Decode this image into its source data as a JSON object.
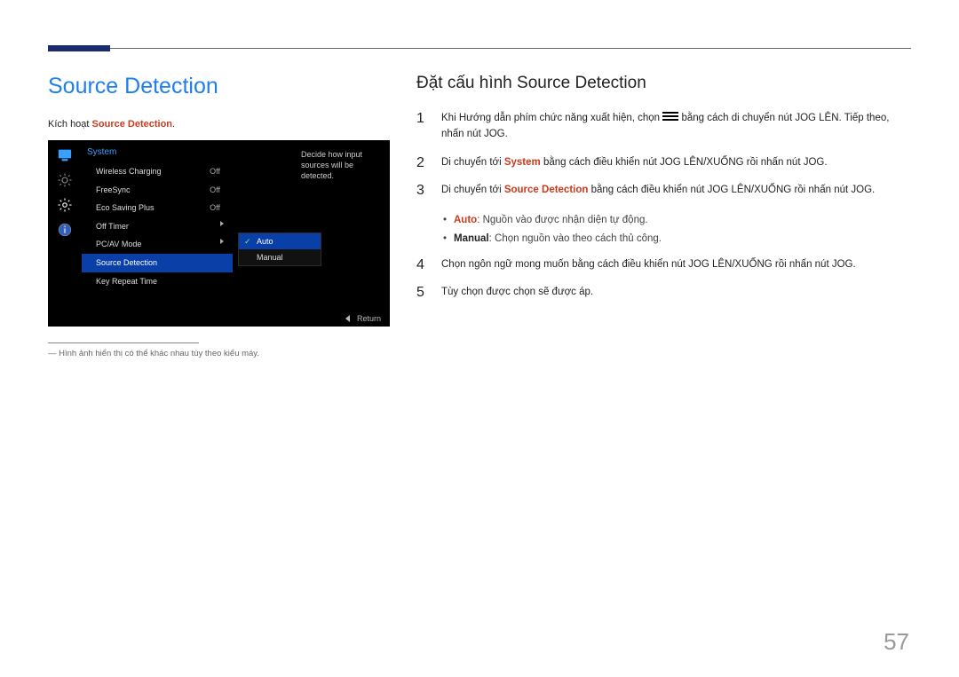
{
  "page_number": "57",
  "header_accent_color": "#1b2b6b",
  "left": {
    "title": "Source Detection",
    "lead_prefix": "Kích hoạt ",
    "lead_strong": "Source Detection",
    "lead_suffix": ".",
    "footnote": "― Hình ảnh hiển thị có thể khác nhau tùy theo kiểu máy."
  },
  "osd": {
    "section_title": "System",
    "help_text": "Decide how input sources will be detected.",
    "footer_label": "Return",
    "icons": [
      "monitor",
      "brightness",
      "gear",
      "info"
    ],
    "menu": [
      {
        "label": "Wireless Charging",
        "value": "Off"
      },
      {
        "label": "FreeSync",
        "value": "Off"
      },
      {
        "label": "Eco Saving Plus",
        "value": "Off"
      },
      {
        "label": "Off Timer",
        "value": "▸"
      },
      {
        "label": "PC/AV Mode",
        "value": "▸"
      },
      {
        "label": "Source Detection",
        "value": "",
        "selected": true
      },
      {
        "label": "Key Repeat Time",
        "value": ""
      }
    ],
    "submenu": [
      {
        "label": "Auto",
        "selected": true
      },
      {
        "label": "Manual"
      }
    ]
  },
  "right": {
    "title": "Đặt cấu hình Source Detection",
    "steps": {
      "1": {
        "pre": "Khi Hướng dẫn phím chức năng xuất hiện, chọn ",
        "post": " bằng cách di chuyển nút JOG LÊN. Tiếp theo, nhấn nút JOG."
      },
      "2": {
        "pre": "Di chuyển tới ",
        "strong": "System",
        "post": " bằng cách điều khiển nút JOG LÊN/XUỐNG rồi nhấn nút JOG."
      },
      "3": {
        "pre": "Di chuyển tới ",
        "strong": "Source Detection",
        "post": " bằng cách điều khiển nút JOG LÊN/XUỐNG rồi nhấn nút JOG."
      },
      "bullets": {
        "auto_label": "Auto",
        "auto_text": ": Nguồn vào được nhận diện tự động.",
        "manual_label": "Manual",
        "manual_text": ": Chọn nguồn vào theo cách thủ công."
      },
      "4": "Chọn ngôn ngữ mong muốn bằng cách điều khiển nút JOG LÊN/XUỐNG rồi nhấn nút JOG.",
      "5": "Tùy chọn được chọn sẽ được áp."
    }
  }
}
